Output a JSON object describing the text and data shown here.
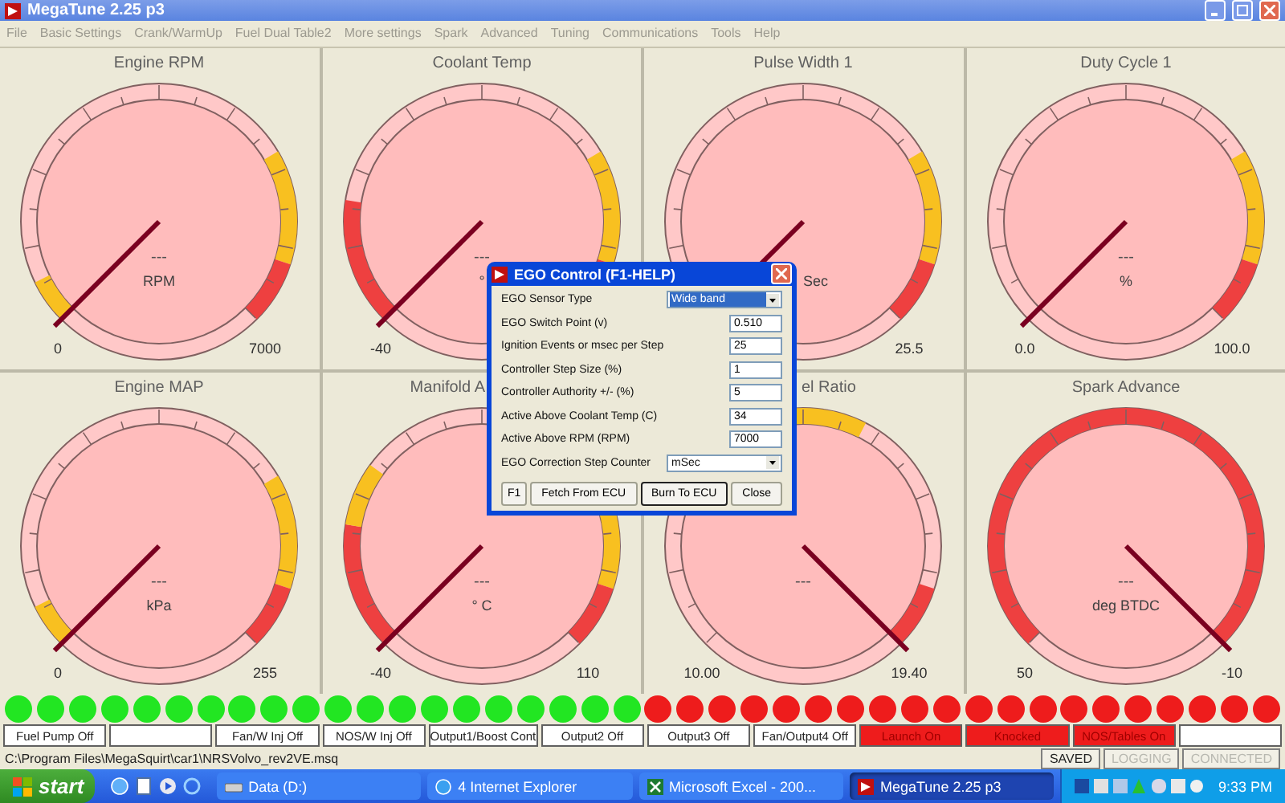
{
  "window": {
    "title": "MegaTune 2.25 p3"
  },
  "menu": [
    "File",
    "Basic Settings",
    "Crank/WarmUp",
    "Fuel Dual Table2",
    "More settings",
    "Spark",
    "Advanced",
    "Tuning",
    "Communications",
    "Tools",
    "Help"
  ],
  "gauges": [
    {
      "title": "Engine RPM",
      "kind": "plain",
      "value": "---",
      "units": "RPM",
      "min": "0",
      "max": "7000",
      "at_max": false,
      "zones": [
        {
          "kind": "low_small",
          "color": "#f8c020"
        },
        {
          "kind": "high_warn",
          "color": "#f8c020"
        },
        {
          "kind": "high_end",
          "color": "#ee4040"
        }
      ]
    },
    {
      "title": "Coolant Temp",
      "kind": "plain",
      "value": "---",
      "units": "°",
      "min": "-40",
      "at_max": false,
      "zones": [
        {
          "kind": "low_wide",
          "color": "#ee4040"
        },
        {
          "kind": "high_warn",
          "color": "#f8c020"
        },
        {
          "kind": "high_end",
          "color": "#ee4040"
        }
      ]
    },
    {
      "title": "Pulse Width 1",
      "kind": "units_cut_left",
      "units": "Sec",
      "max": "25.5",
      "at_max": false,
      "zones": [
        {
          "kind": "high_warn",
          "color": "#f8c020"
        },
        {
          "kind": "high_end",
          "color": "#ee4040"
        }
      ]
    },
    {
      "title": "Duty Cycle 1",
      "kind": "plain",
      "value": "---",
      "units": "%",
      "min": "0.0",
      "max": "100.0",
      "at_max": false,
      "zones": [
        {
          "kind": "high_warn",
          "color": "#f8c020"
        },
        {
          "kind": "high_end",
          "color": "#ee4040"
        }
      ]
    },
    {
      "title": "Engine MAP",
      "kind": "plain",
      "value": "---",
      "units": "kPa",
      "min": "0",
      "max": "255",
      "at_max": false,
      "zones": [
        {
          "kind": "low_small",
          "color": "#f8c020"
        },
        {
          "kind": "high_warn",
          "color": "#f8c020"
        },
        {
          "kind": "high_end",
          "color": "#ee4040"
        }
      ]
    },
    {
      "title": "Manifold A",
      "kind": "title_cut_right",
      "value": "---",
      "units": "° C",
      "min": "-40",
      "max": "110",
      "at_max": false,
      "zones": [
        {
          "kind": "low_wide",
          "color": "#ee4040"
        },
        {
          "kind": "low_next",
          "color": "#f8c020"
        },
        {
          "kind": "high_warn",
          "color": "#f8c020"
        },
        {
          "kind": "high_end",
          "color": "#ee4040"
        }
      ]
    },
    {
      "title": "el Ratio",
      "kind": "title_cut_left",
      "value": "---",
      "min": "10.00",
      "max": "19.40",
      "at_max": true,
      "zones": [
        {
          "kind": "mid",
          "color": "#f8c020"
        },
        {
          "kind": "high_end",
          "color": "#ee4040"
        }
      ]
    },
    {
      "title": "Spark Advance",
      "kind": "plain",
      "value": "---",
      "units": "deg BTDC",
      "min": "50",
      "max": "-10",
      "at_max": true,
      "zones": [
        {
          "kind": "full",
          "color": "#ee4040"
        }
      ]
    }
  ],
  "dialog": {
    "title": "EGO Control (F1-HELP)",
    "fields": [
      {
        "label": "EGO Sensor Type",
        "kind": "select",
        "value": "Wide band",
        "highlighted": true
      },
      {
        "label": "EGO Switch Point (v)",
        "kind": "text",
        "value": "0.510"
      },
      {
        "label": "Ignition Events or msec per Step",
        "kind": "text",
        "value": "25"
      },
      {
        "label": "Controller Step Size (%)",
        "kind": "text",
        "value": "1"
      },
      {
        "label": "Controller Authority +/- (%)",
        "kind": "text",
        "value": "5"
      },
      {
        "label": "Active Above Coolant Temp (C)",
        "kind": "text",
        "value": "34"
      },
      {
        "label": "Active Above RPM (RPM)",
        "kind": "text",
        "value": "7000"
      },
      {
        "label": "EGO Correction Step Counter",
        "kind": "select",
        "value": "mSec",
        "highlighted": false
      }
    ],
    "buttons": [
      {
        "label": "F1",
        "default": false
      },
      {
        "label": "Fetch From ECU",
        "default": false
      },
      {
        "label": "Burn To ECU",
        "default": true
      },
      {
        "label": "Close",
        "default": false
      }
    ]
  },
  "leds": [
    {
      "color": "#22e622"
    },
    {
      "color": "#22e622"
    },
    {
      "color": "#22e622"
    },
    {
      "color": "#22e622"
    },
    {
      "color": "#22e622"
    },
    {
      "color": "#22e622"
    },
    {
      "color": "#22e622"
    },
    {
      "color": "#22e622"
    },
    {
      "color": "#22e622"
    },
    {
      "color": "#22e622"
    },
    {
      "color": "#22e622"
    },
    {
      "color": "#22e622"
    },
    {
      "color": "#22e622"
    },
    {
      "color": "#22e622"
    },
    {
      "color": "#22e622"
    },
    {
      "color": "#22e622"
    },
    {
      "color": "#22e622"
    },
    {
      "color": "#22e622"
    },
    {
      "color": "#22e622"
    },
    {
      "color": "#22e622"
    },
    {
      "color": "#ee1c1c"
    },
    {
      "color": "#ee1c1c"
    },
    {
      "color": "#ee1c1c"
    },
    {
      "color": "#ee1c1c"
    },
    {
      "color": "#ee1c1c"
    },
    {
      "color": "#ee1c1c"
    },
    {
      "color": "#ee1c1c"
    },
    {
      "color": "#ee1c1c"
    },
    {
      "color": "#ee1c1c"
    },
    {
      "color": "#ee1c1c"
    },
    {
      "color": "#ee1c1c"
    },
    {
      "color": "#ee1c1c"
    },
    {
      "color": "#ee1c1c"
    },
    {
      "color": "#ee1c1c"
    },
    {
      "color": "#ee1c1c"
    },
    {
      "color": "#ee1c1c"
    },
    {
      "color": "#ee1c1c"
    },
    {
      "color": "#ee1c1c"
    },
    {
      "color": "#ee1c1c"
    },
    {
      "color": "#ee1c1c"
    }
  ],
  "indicators": [
    {
      "label": "Fuel Pump Off",
      "active": false
    },
    {
      "active": false
    },
    {
      "label": "Fan/W Inj Off",
      "active": false
    },
    {
      "label": "NOS/W Inj Off",
      "active": false
    },
    {
      "label": "Output1/Boost Cont",
      "active": false
    },
    {
      "label": "Output2 Off",
      "active": false
    },
    {
      "label": "Output3 Off",
      "active": false
    },
    {
      "label": "Fan/Output4 Off",
      "active": false
    },
    {
      "label": "Launch On",
      "active": true
    },
    {
      "label": "Knocked",
      "active": true
    },
    {
      "label": "NOS/Tables On",
      "active": true
    },
    {
      "active": false
    }
  ],
  "status_bar": {
    "path": "C:\\Program Files\\MegaSquirt\\car1\\NRSVolvo_rev2VE.msq",
    "flags": [
      {
        "label": "SAVED",
        "disabled": false
      },
      {
        "label": "LOGGING",
        "disabled": true
      },
      {
        "label": "CONNECTED",
        "disabled": true
      }
    ]
  },
  "taskbar": {
    "start": "start",
    "tasks": [
      {
        "label": "Data (D:)",
        "selected": false,
        "kind": "folder"
      },
      {
        "label": "4 Internet Explorer",
        "selected": false,
        "kind": "browser"
      },
      {
        "label": "Microsoft Excel - 200...",
        "selected": false,
        "kind": "excel"
      },
      {
        "label": "MegaTune 2.25 p3",
        "selected": true,
        "kind": "app"
      }
    ],
    "clock": "9:33 PM"
  }
}
